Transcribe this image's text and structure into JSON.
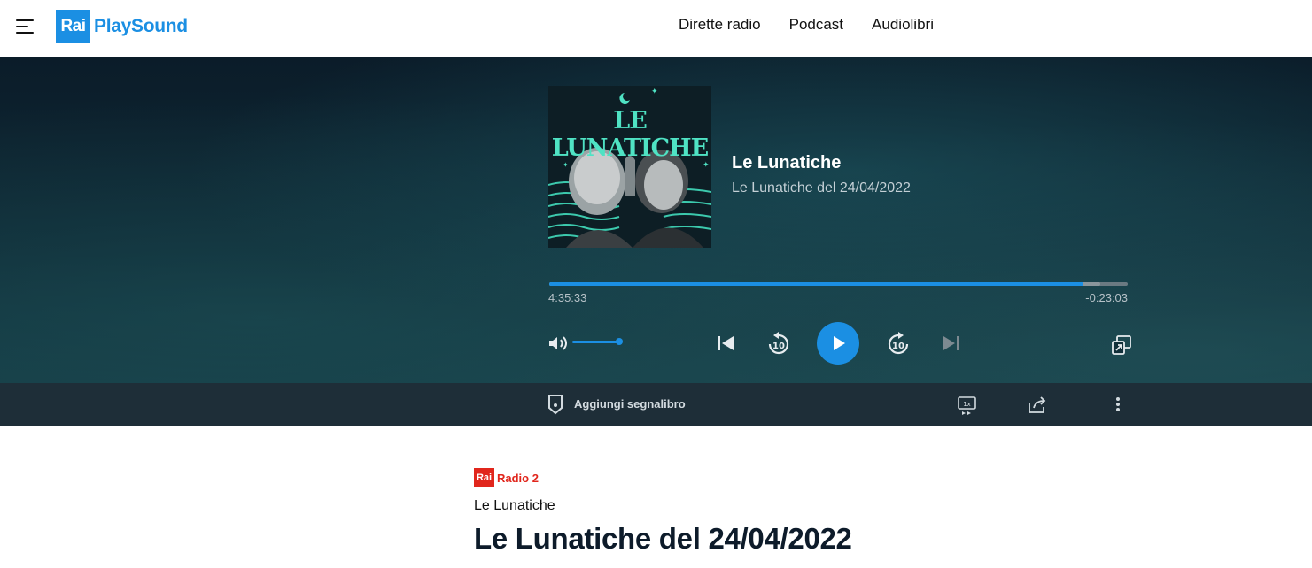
{
  "header": {
    "logo_rai": "Rai",
    "logo_text": "PlaySound",
    "nav": [
      {
        "label": "Dirette radio"
      },
      {
        "label": "Podcast"
      },
      {
        "label": "Audiolibri"
      }
    ],
    "icons": {
      "menu": "hamburger-menu-icon"
    }
  },
  "player": {
    "cover_title": "LE LUNATICHE",
    "title": "Le Lunatiche",
    "subtitle": "Le Lunatiche del 24/04/2022",
    "elapsed": "4:35:33",
    "remaining": "-0:23:03",
    "progress_fraction": 0.923,
    "buffered_fraction": 0.952,
    "volume_fraction": 1.0,
    "colors": {
      "accent": "#1b8fe3",
      "background": "#0f2a36"
    },
    "controls": {
      "volume": "speaker-icon",
      "previous": "skip-previous-icon",
      "rewind": "rewind-10-icon",
      "play": "play-icon",
      "forward": "forward-10-icon",
      "next": "skip-next-icon",
      "popout": "popout-icon"
    },
    "rewind_seconds": "10",
    "forward_seconds": "10"
  },
  "actions": {
    "bookmark_label": "Aggiungi segnalibro",
    "speed_label": "1x",
    "icons": [
      "bookmark-icon",
      "playback-speed-icon",
      "share-icon",
      "more-vertical-icon"
    ]
  },
  "content": {
    "channel_rai": "Rai",
    "channel_name": "Radio 2",
    "channel_color": "#e1261c",
    "program": "Le Lunatiche",
    "episode_title": "Le Lunatiche del 24/04/2022"
  }
}
